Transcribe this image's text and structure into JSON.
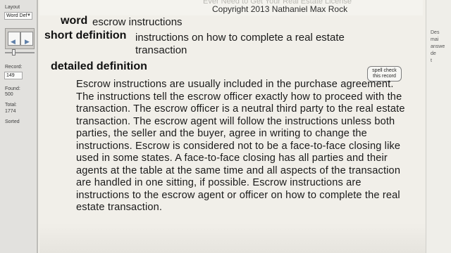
{
  "sidebar": {
    "layout_label": "Layout",
    "layout_value": "Word Def",
    "record_label": "Record:",
    "record_value": "149",
    "found_label": "Found:",
    "found_value": "500",
    "total_label": "Total:",
    "total_value": "1774",
    "sort_status": "Sorted"
  },
  "header": {
    "faded_title": "Ever Need to Get Your Real Estate License",
    "copyright": "Copyright 2013 Nathaniel Max Rock"
  },
  "record": {
    "word_label": "word",
    "word_value": "escrow instructions",
    "short_label": "short definition",
    "short_value": "instructions on how to complete a real estate transaction",
    "detailed_label": "detailed definition",
    "detailed_value": "Escrow instructions are usually included in the purchase agreement. The instructions tell the escrow officer exactly how to proceed with the transaction. The escrow officer is a neutral third party to the real estate transaction. The escrow agent will follow the instructions unless both parties, the seller and the buyer, agree in writing to change the instructions. Escrow is considered not to be a face-to-face closing like used in some states. A face-to-face closing has all parties and their agents at the table at the same time and all aspects of the transaction are handled in one sitting, if possible. Escrow instructions are instructions to the escrow agent or officer on how to complete the real estate transaction.",
    "spell_check_label": "spell check this record"
  },
  "right_panel": {
    "partial_text": "Des\nmai\nanswe\nde\nt"
  }
}
